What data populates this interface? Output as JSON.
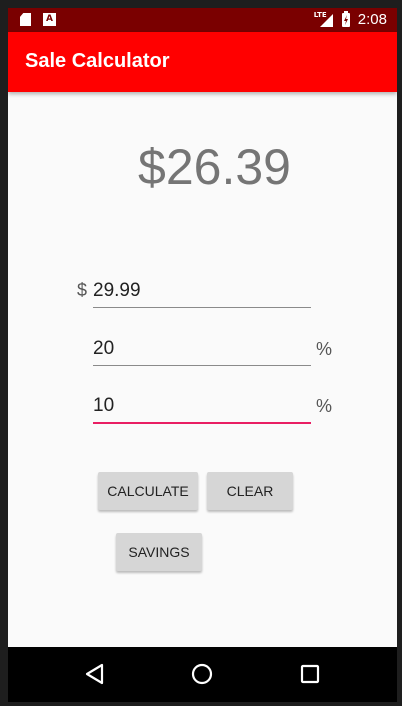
{
  "status_bar": {
    "time": "2:08",
    "network": "LTE",
    "icons": [
      "sd-card-icon",
      "a-notification-icon",
      "lte-signal-icon",
      "battery-charging-icon"
    ]
  },
  "app_bar": {
    "title": "Sale Calculator"
  },
  "result": {
    "value": "$26.39"
  },
  "fields": {
    "price": {
      "prefix": "$",
      "value": "29.99"
    },
    "discount": {
      "value": "20",
      "suffix": "%"
    },
    "tax": {
      "value": "10",
      "suffix": "%"
    }
  },
  "buttons": {
    "calculate": "CALCULATE",
    "clear": "CLEAR",
    "savings": "SAVINGS"
  },
  "nav": {
    "items": [
      "back-icon",
      "home-icon",
      "recents-icon"
    ]
  },
  "colors": {
    "status_bar": "#7a0000",
    "app_bar": "#ff0000",
    "accent": "#e91e63",
    "result_text": "#757575"
  }
}
